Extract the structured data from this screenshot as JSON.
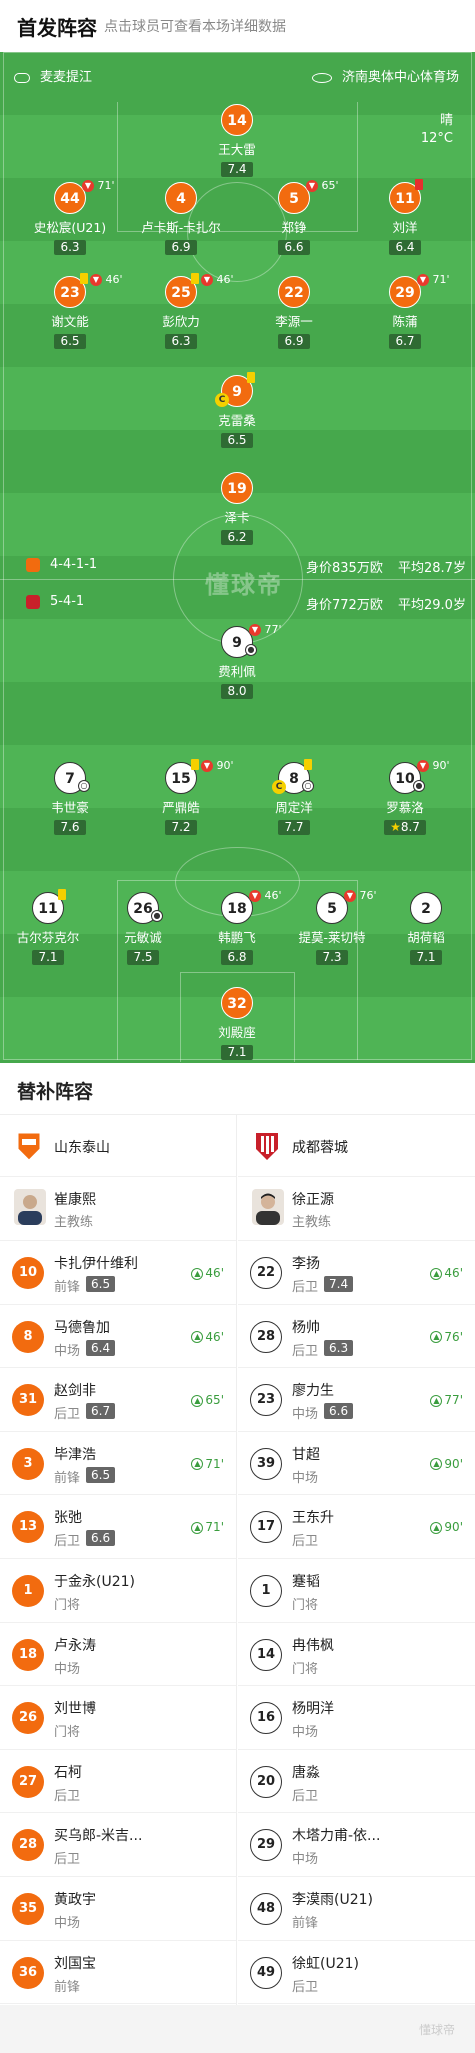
{
  "header": {
    "title": "首发阵容",
    "subtitle": "点击球员可查看本场详细数据"
  },
  "match": {
    "referee": "麦麦提江",
    "venue": "济南奥体中心体育场",
    "weather": "晴",
    "temperature": "12°C",
    "watermark": "懂球帝"
  },
  "home_info": {
    "formation": "4-4-1-1",
    "value": "身价835万欧",
    "age": "平均28.7岁"
  },
  "away_info": {
    "formation": "5-4-1",
    "value": "身价772万欧",
    "age": "平均29.0岁"
  },
  "home_lineup": [
    {
      "num": "14",
      "name": "王大雷",
      "rating": "7.4"
    },
    {
      "num": "44",
      "name": "史松宸(U21)",
      "rating": "6.3",
      "sub": "71'"
    },
    {
      "num": "4",
      "name": "卢卡斯-卡扎尔",
      "rating": "6.9"
    },
    {
      "num": "5",
      "name": "郑铮",
      "rating": "6.6",
      "sub": "65'"
    },
    {
      "num": "11",
      "name": "刘洋",
      "rating": "6.4"
    },
    {
      "num": "23",
      "name": "谢文能",
      "rating": "6.5",
      "sub": "46'"
    },
    {
      "num": "25",
      "name": "彭欣力",
      "rating": "6.3",
      "sub": "46'"
    },
    {
      "num": "22",
      "name": "李源一",
      "rating": "6.9"
    },
    {
      "num": "29",
      "name": "陈蒲",
      "rating": "6.7",
      "sub": "71'"
    },
    {
      "num": "9",
      "name": "克雷桑",
      "rating": "6.5"
    },
    {
      "num": "19",
      "name": "泽卡",
      "rating": "6.2"
    }
  ],
  "away_lineup": [
    {
      "num": "9",
      "name": "费利佩",
      "rating": "8.0",
      "sub": "77'"
    },
    {
      "num": "7",
      "name": "韦世豪",
      "rating": "7.6"
    },
    {
      "num": "15",
      "name": "严鼎皓",
      "rating": "7.2",
      "sub": "90'"
    },
    {
      "num": "8",
      "name": "周定洋",
      "rating": "7.7"
    },
    {
      "num": "10",
      "name": "罗慕洛",
      "rating": "8.7",
      "sub": "90'"
    },
    {
      "num": "11",
      "name": "古尔芬克尔",
      "rating": "7.1"
    },
    {
      "num": "26",
      "name": "元敏诚",
      "rating": "7.5"
    },
    {
      "num": "18",
      "name": "韩鹏飞",
      "rating": "6.8",
      "sub": "46'"
    },
    {
      "num": "5",
      "name": "提莫-莱切特",
      "rating": "7.3",
      "sub": "76'"
    },
    {
      "num": "2",
      "name": "胡荷韬",
      "rating": "7.1"
    },
    {
      "num": "32",
      "name": "刘殿座",
      "rating": "7.1"
    }
  ],
  "subs": {
    "title": "替补阵容",
    "home_team": "山东泰山",
    "away_team": "成都蓉城",
    "home_coach": {
      "name": "崔康熙",
      "role": "主教练"
    },
    "away_coach": {
      "name": "徐正源",
      "role": "主教练"
    },
    "home": [
      {
        "num": "10",
        "name": "卡扎伊什维利",
        "pos": "前锋",
        "rating": "6.5",
        "time": "46'"
      },
      {
        "num": "8",
        "name": "马德鲁加",
        "pos": "中场",
        "rating": "6.4",
        "time": "46'"
      },
      {
        "num": "31",
        "name": "赵剑非",
        "pos": "后卫",
        "rating": "6.7",
        "time": "65'"
      },
      {
        "num": "3",
        "name": "毕津浩",
        "pos": "前锋",
        "rating": "6.5",
        "time": "71'"
      },
      {
        "num": "13",
        "name": "张弛",
        "pos": "后卫",
        "rating": "6.6",
        "time": "71'"
      },
      {
        "num": "1",
        "name": "于金永(U21)",
        "pos": "门将"
      },
      {
        "num": "18",
        "name": "卢永涛",
        "pos": "中场"
      },
      {
        "num": "26",
        "name": "刘世博",
        "pos": "门将"
      },
      {
        "num": "27",
        "name": "石柯",
        "pos": "后卫"
      },
      {
        "num": "28",
        "name": "买乌郎-米吉...",
        "pos": "后卫"
      },
      {
        "num": "35",
        "name": "黄政宇",
        "pos": "中场"
      },
      {
        "num": "36",
        "name": "刘国宝",
        "pos": "前锋"
      }
    ],
    "away": [
      {
        "num": "22",
        "name": "李扬",
        "pos": "后卫",
        "rating": "7.4",
        "time": "46'"
      },
      {
        "num": "28",
        "name": "杨帅",
        "pos": "后卫",
        "rating": "6.3",
        "time": "76'"
      },
      {
        "num": "23",
        "name": "廖力生",
        "pos": "中场",
        "rating": "6.6",
        "time": "77'"
      },
      {
        "num": "39",
        "name": "甘超",
        "pos": "中场",
        "time": "90'"
      },
      {
        "num": "17",
        "name": "王东升",
        "pos": "后卫",
        "time": "90'"
      },
      {
        "num": "1",
        "name": "蹇韬",
        "pos": "门将"
      },
      {
        "num": "14",
        "name": "冉伟枫",
        "pos": "门将"
      },
      {
        "num": "16",
        "name": "杨明洋",
        "pos": "中场"
      },
      {
        "num": "20",
        "name": "唐淼",
        "pos": "后卫"
      },
      {
        "num": "29",
        "name": "木塔力甫-依...",
        "pos": "中场"
      },
      {
        "num": "48",
        "name": "李漠雨(U21)",
        "pos": "前锋"
      },
      {
        "num": "49",
        "name": "徐虹(U21)",
        "pos": "后卫"
      }
    ]
  },
  "colors": {
    "home": "#f26b0f",
    "pitch": "#4fb455"
  }
}
